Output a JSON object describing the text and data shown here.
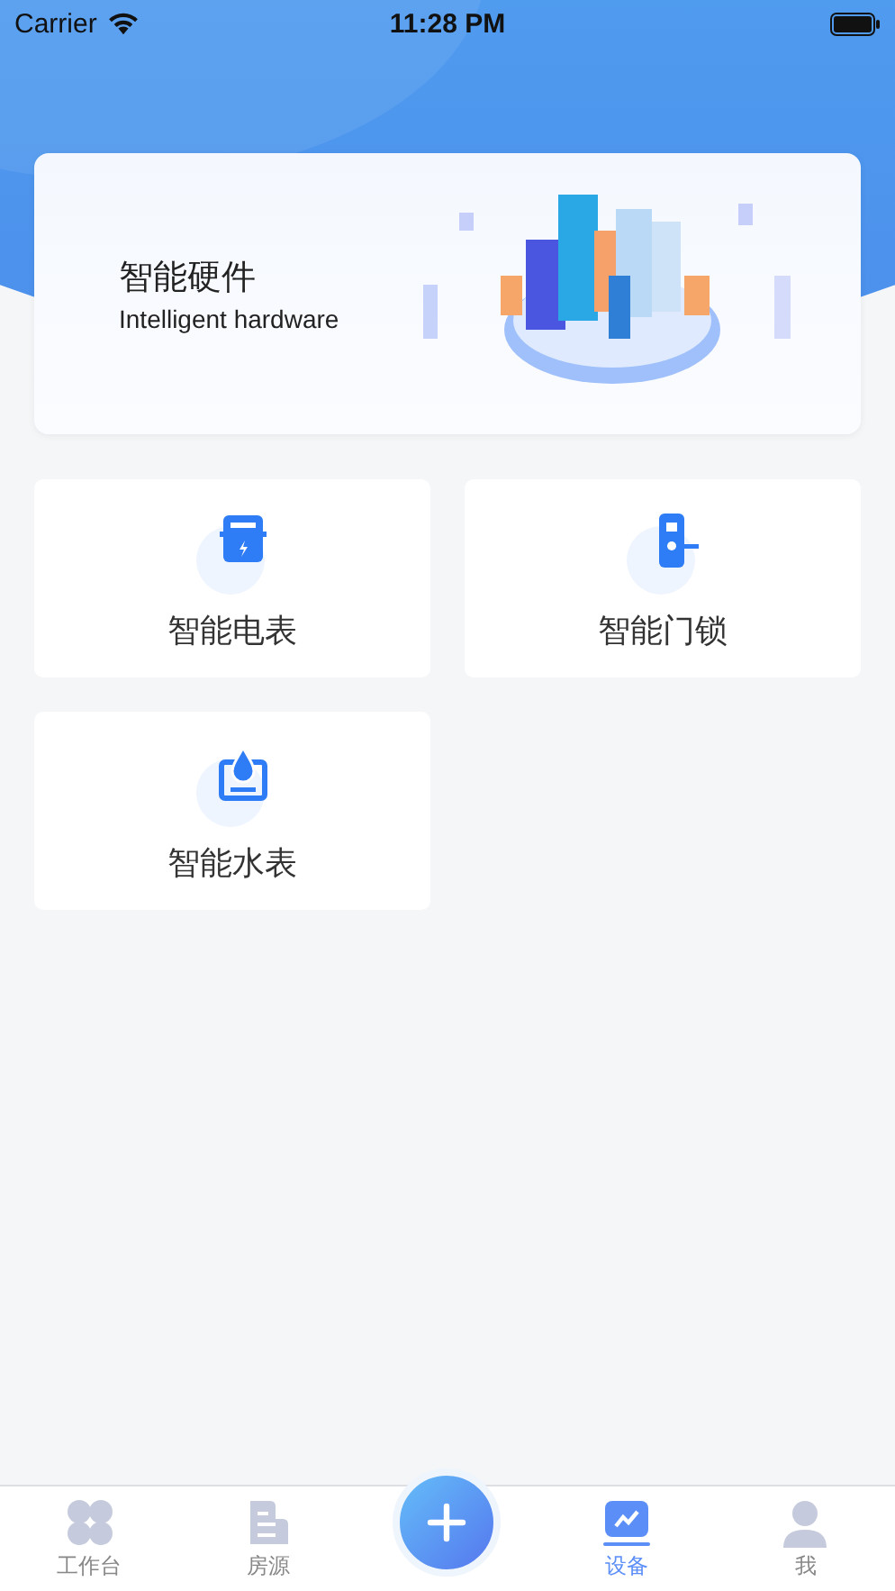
{
  "status_bar": {
    "carrier": "Carrier",
    "time": "11:28 PM"
  },
  "banner": {
    "title": "智能硬件",
    "subtitle": "Intelligent hardware"
  },
  "devices": [
    {
      "label": "智能电表",
      "kind": "meter"
    },
    {
      "label": "智能门锁",
      "kind": "lock"
    },
    {
      "label": "智能水表",
      "kind": "water"
    }
  ],
  "tab_bar": [
    {
      "label": "工作台",
      "kind": "grid",
      "selected": false
    },
    {
      "label": "房源",
      "kind": "house",
      "selected": false
    },
    {
      "kind": "add",
      "selected": false
    },
    {
      "label": "设备",
      "kind": "chart",
      "selected": true
    },
    {
      "label": "我",
      "kind": "user",
      "selected": false
    }
  ]
}
